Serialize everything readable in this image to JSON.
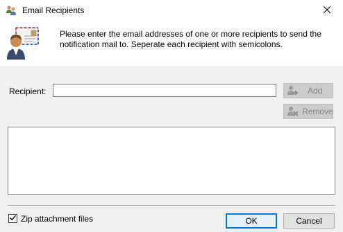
{
  "window": {
    "title": "Email Recipients",
    "icon": "users-icon",
    "close_icon": "close-icon"
  },
  "header": {
    "icon": "email-contact-icon",
    "instructions": "Please enter the email addresses of one or more recipients to send the notification mail to. Seperate each recipient with semicolons."
  },
  "recipient": {
    "label": "Recipient:",
    "value": "",
    "placeholder": ""
  },
  "buttons": {
    "add": "Add",
    "remove": "Remove",
    "ok": "OK",
    "cancel": "Cancel"
  },
  "recipients_list": [],
  "options": {
    "zip_label": "Zip attachment files",
    "zip_checked": true
  },
  "colors": {
    "accent": "#0078d7",
    "header_bg": "#ffffff",
    "dialog_bg": "#f0f0f0"
  }
}
